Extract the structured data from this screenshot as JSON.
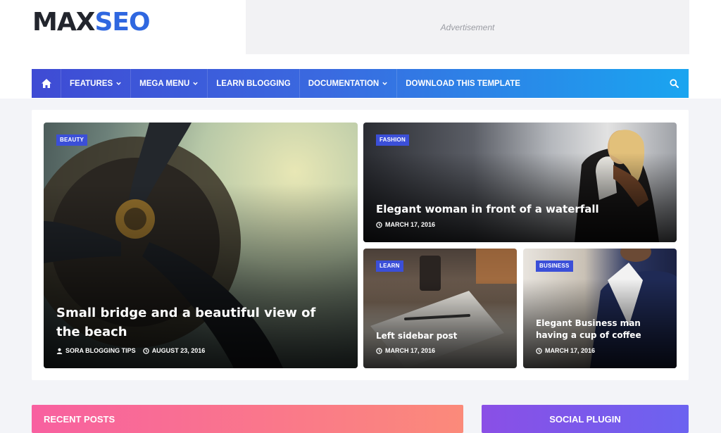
{
  "logo": {
    "part1": "MAX",
    "part2": "SEO"
  },
  "ad": {
    "label": "Advertisement"
  },
  "nav": {
    "items": [
      {
        "label": "FEATURES",
        "dropdown": true
      },
      {
        "label": "MEGA MENU",
        "dropdown": true
      },
      {
        "label": "LEARN BLOGGING",
        "dropdown": false
      },
      {
        "label": "DOCUMENTATION",
        "dropdown": true
      },
      {
        "label": "DOWNLOAD THIS TEMPLATE",
        "dropdown": false
      }
    ],
    "home_icon": "home-icon",
    "search_icon": "search-icon"
  },
  "featured": [
    {
      "tag": "BEAUTY",
      "title": "Small bridge and a beautiful view of the beach",
      "author": "SORA BLOGGING TIPS",
      "date": "AUGUST 23, 2016"
    },
    {
      "tag": "FASHION",
      "title": "Elegant woman in front of a waterfall",
      "date": "MARCH 17, 2016"
    },
    {
      "tag": "LEARN",
      "title": "Left sidebar post",
      "date": "MARCH 17, 2016"
    },
    {
      "tag": "BUSINESS",
      "title": "Elegant Business man having a cup of coffee",
      "date": "MARCH 17, 2016"
    }
  ],
  "sections": {
    "recent_posts": "RECENT POSTS",
    "social_plugin": "SOCIAL PLUGIN"
  },
  "colors": {
    "brand_dark": "#22252d",
    "brand_blue": "#2f67e0",
    "tag_bg": "#3b4fd8"
  }
}
